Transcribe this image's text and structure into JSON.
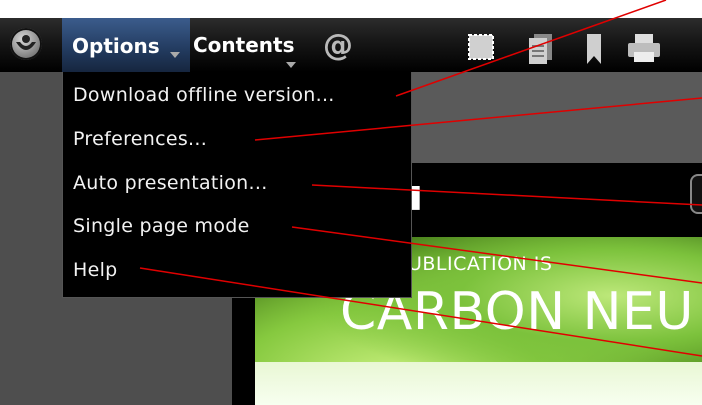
{
  "toolbar": {
    "menus": [
      {
        "label": "Options"
      },
      {
        "label": "Contents"
      }
    ],
    "icons": [
      "app-logo-icon",
      "at-sign-icon",
      "select-area-icon",
      "pages-icon",
      "bookmark-icon",
      "print-icon"
    ],
    "at_symbol": "@"
  },
  "dropdown": {
    "items": [
      {
        "label": "Download offline version..."
      },
      {
        "label": "Preferences..."
      },
      {
        "label": "Auto presentation..."
      },
      {
        "label": "Single page mode"
      },
      {
        "label": "Help"
      }
    ]
  },
  "document": {
    "logo_fragment": "u",
    "headline_small": "PUBLICATION IS",
    "headline_large": "CARBON NEU"
  },
  "colors": {
    "annotation_line": "#e00000",
    "options_highlight": "#2a4670"
  }
}
